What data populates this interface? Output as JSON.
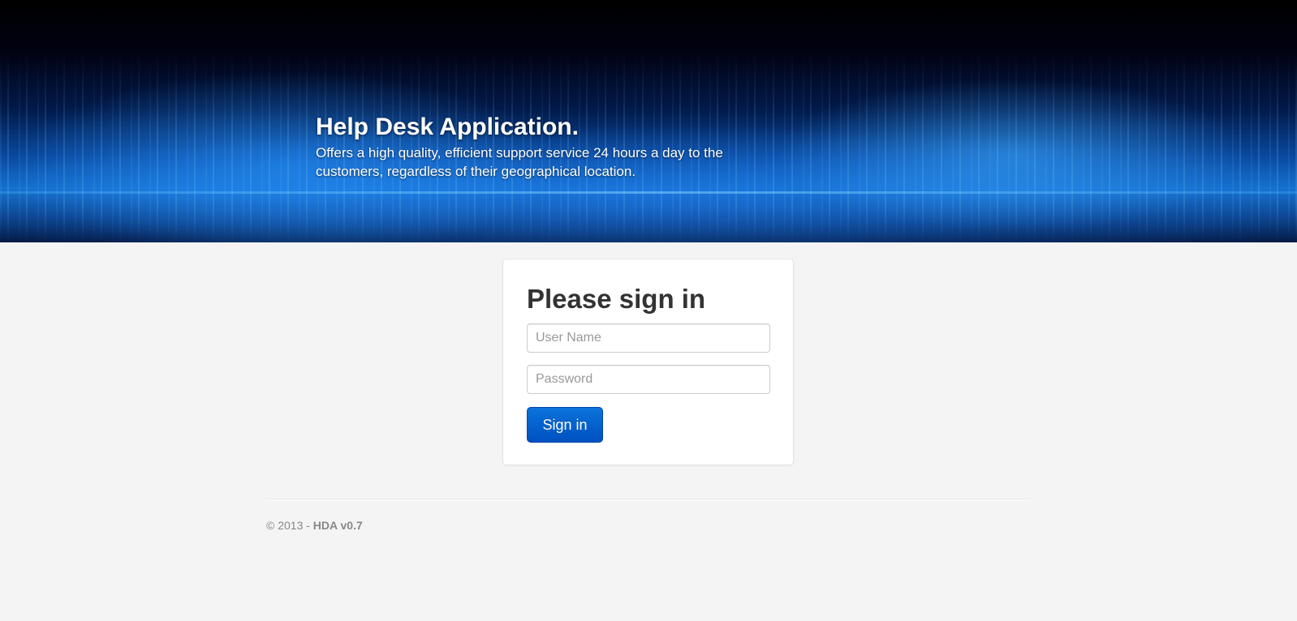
{
  "header": {
    "title": "Help Desk Application.",
    "subtitle": "Offers a high quality, efficient support service 24 hours a day to the customers, regardless of their geographical location."
  },
  "signin": {
    "heading": "Please sign in",
    "username": {
      "value": "",
      "placeholder": "User Name"
    },
    "password": {
      "value": "",
      "placeholder": "Password"
    },
    "button_label": "Sign in"
  },
  "footer": {
    "copyright": "© 2013 - ",
    "version": "HDA v0.7"
  },
  "colors": {
    "page_background": "#f4f4f4",
    "button_primary": "#0058c8",
    "heading_text": "#333333",
    "footer_text": "#888888"
  }
}
